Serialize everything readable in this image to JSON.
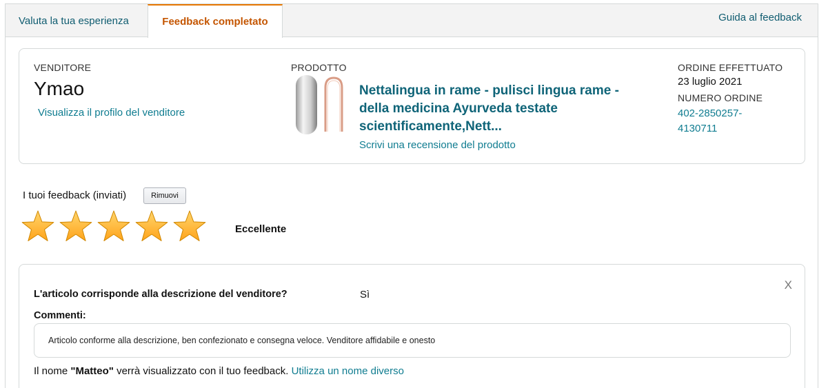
{
  "tabs": {
    "rate": "Valuta la tua esperienza",
    "done": "Feedback completato",
    "guide": "Guida al feedback"
  },
  "seller": {
    "label": "VENDITORE",
    "name": "Ymao",
    "profile_link": "Visualizza il profilo del venditore"
  },
  "product": {
    "label": "PRODOTTO",
    "title": "Nettalingua in rame - pulisci lingua rame - della medicina Ayurveda testate scientificamente,Nett...",
    "review_link": "Scrivi una recensione del prodotto"
  },
  "order": {
    "date_label": "ORDINE EFFETTUATO",
    "date": "23 luglio 2021",
    "number_label": "NUMERO ORDINE",
    "number": "402-2850257-4130711"
  },
  "feedback": {
    "label": "I tuoi feedback (inviati)",
    "remove_button": "Rimuovi",
    "stars_filled": 5,
    "stars_total": 5,
    "rating_text": "Eccellente"
  },
  "details": {
    "close": "X",
    "question": "L'articolo corrisponde alla descrizione del venditore?",
    "answer": "Sì",
    "comments_label": "Commenti:",
    "comment": "Articolo conforme alla descrizione, ben confezionato e consegna veloce. Venditore affidabile e onesto",
    "name_prefix": "Il nome ",
    "name": "\"Matteo\"",
    "name_suffix": " verrà visualizzato con il tuo feedback. ",
    "name_link": "Utilizza un nome diverso"
  },
  "colors": {
    "link": "#0f7c90",
    "active_tab": "#c45500",
    "tab_accent": "#e77600",
    "star": "#ffa41c"
  }
}
